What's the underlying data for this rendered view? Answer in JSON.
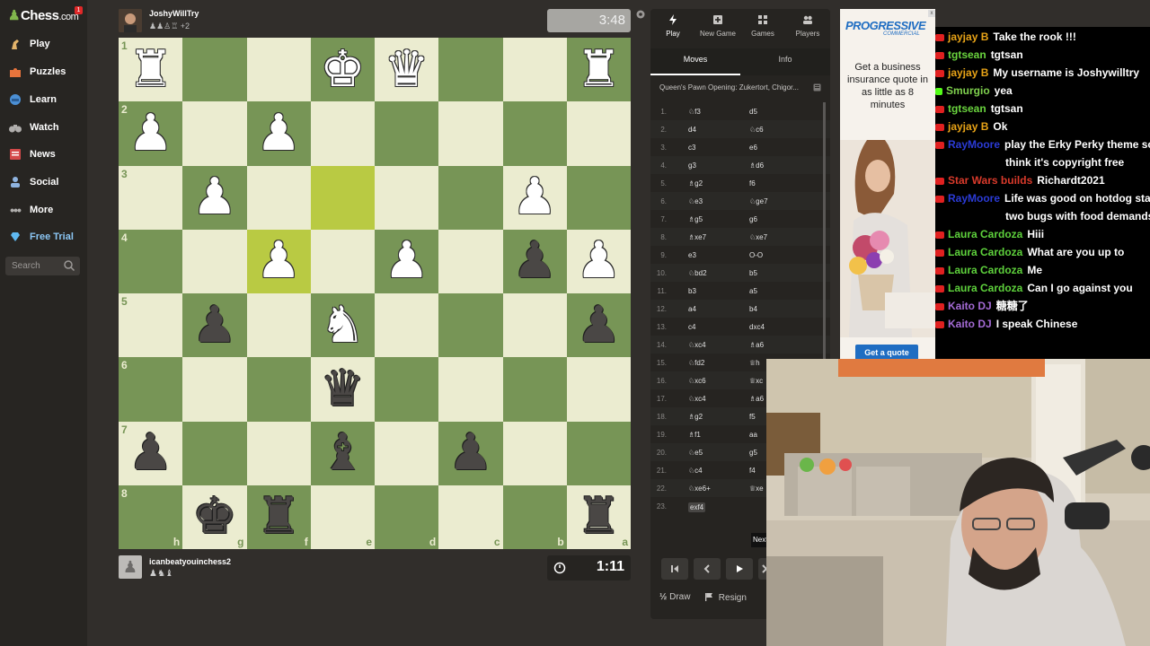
{
  "sidebar": {
    "logo": "Chess",
    "logo_suffix": ".com",
    "logo_badge": "1",
    "items": [
      {
        "label": "Play",
        "icon": "play-hand-icon"
      },
      {
        "label": "Puzzles",
        "icon": "puzzle-icon"
      },
      {
        "label": "Learn",
        "icon": "learn-hat-icon"
      },
      {
        "label": "Watch",
        "icon": "binoculars-icon"
      },
      {
        "label": "News",
        "icon": "news-icon"
      },
      {
        "label": "Social",
        "icon": "social-icon"
      },
      {
        "label": "More",
        "icon": "more-dots-icon"
      },
      {
        "label": "Free Trial",
        "icon": "diamond-icon"
      }
    ],
    "search_placeholder": "Search"
  },
  "top_player": {
    "name": "JoshyWillTry",
    "captured": "♟♟♙♖ +2"
  },
  "top_clock": "3:48",
  "bottom_player": {
    "name": "icanbeatyouinchess2",
    "captured": "♟♞♝"
  },
  "bottom_clock": "1:11",
  "board": {
    "rows": [
      [
        "wR",
        "",
        "",
        "wK",
        "wQ",
        "",
        "",
        "wR"
      ],
      [
        "wP",
        "",
        "wP",
        "",
        "",
        "",
        "",
        ""
      ],
      [
        "",
        "wP",
        "",
        "",
        "",
        "",
        "wP",
        ""
      ],
      [
        "",
        "",
        "wP",
        "",
        "wP",
        "",
        "bP",
        "wP"
      ],
      [
        "",
        "bP",
        "",
        "wN",
        "",
        "",
        "",
        "bP"
      ],
      [
        "",
        "",
        "",
        "bQ",
        "",
        "",
        "",
        ""
      ],
      [
        "bP",
        "",
        "",
        "bB",
        "",
        "bP",
        "",
        ""
      ],
      [
        "",
        "bK",
        "bR",
        "",
        "",
        "",
        "",
        "bR"
      ]
    ],
    "ranks": [
      "1",
      "2",
      "3",
      "4",
      "5",
      "6",
      "7",
      "8"
    ],
    "files": [
      "h",
      "g",
      "f",
      "e",
      "d",
      "c",
      "b",
      "a"
    ],
    "highlight": [
      [
        2,
        3
      ],
      [
        3,
        2
      ]
    ]
  },
  "panel": {
    "tabs": [
      {
        "label": "Play",
        "icon": "lightning-icon"
      },
      {
        "label": "New Game",
        "icon": "plus-square-icon"
      },
      {
        "label": "Games",
        "icon": "games-grid-icon"
      },
      {
        "label": "Players",
        "icon": "players-icon"
      }
    ],
    "subtabs": [
      "Moves",
      "Info"
    ],
    "opening": "Queen's Pawn Opening: Zukertort, Chigor...",
    "moves": [
      {
        "n": "1.",
        "w": "♘f3",
        "b": "d5"
      },
      {
        "n": "2.",
        "w": "d4",
        "b": "♘c6"
      },
      {
        "n": "3.",
        "w": "c3",
        "b": "e6"
      },
      {
        "n": "4.",
        "w": "g3",
        "b": "♗d6"
      },
      {
        "n": "5.",
        "w": "♗g2",
        "b": "f6"
      },
      {
        "n": "6.",
        "w": "♘e3",
        "b": "♘ge7"
      },
      {
        "n": "7.",
        "w": "♗g5",
        "b": "g6"
      },
      {
        "n": "8.",
        "w": "♗xe7",
        "b": "♘xe7"
      },
      {
        "n": "9.",
        "w": "e3",
        "b": "O-O"
      },
      {
        "n": "10.",
        "w": "♘bd2",
        "b": "b5"
      },
      {
        "n": "11.",
        "w": "b3",
        "b": "a5"
      },
      {
        "n": "12.",
        "w": "a4",
        "b": "b4"
      },
      {
        "n": "13.",
        "w": "c4",
        "b": "dxc4"
      },
      {
        "n": "14.",
        "w": "♘xc4",
        "b": "♗a6"
      },
      {
        "n": "15.",
        "w": "♘fd2",
        "b": "♕h"
      },
      {
        "n": "16.",
        "w": "♘xc6",
        "b": "♕xc"
      },
      {
        "n": "17.",
        "w": "♘xc4",
        "b": "♗a6"
      },
      {
        "n": "18.",
        "w": "♗g2",
        "b": "f5"
      },
      {
        "n": "19.",
        "w": "♗f1",
        "b": "aa"
      },
      {
        "n": "20.",
        "w": "♘e5",
        "b": "g5"
      },
      {
        "n": "21.",
        "w": "♘c4",
        "b": "f4"
      },
      {
        "n": "22.",
        "w": "♘xe6+",
        "b": "♕xe"
      },
      {
        "n": "23.",
        "w": "exf4",
        "b": ""
      }
    ],
    "draw_label": "Draw",
    "resign_label": "Resign",
    "draw_icon_text": "½",
    "next_tip": "Next"
  },
  "ad": {
    "brand": "PROGRESSIVE",
    "brand_sub": "COMMERCIAL",
    "copy": "Get a business insurance quote in as little as 8 minutes",
    "cta": "Get a quote",
    "close": "x"
  },
  "chat": [
    {
      "user": "jayjay B",
      "color": "#e8a317",
      "badge": "yt",
      "msg": "Take the rook !!!"
    },
    {
      "user": "tgtsean",
      "color": "#6ad43e",
      "badge": "yt",
      "msg": "tgtsan"
    },
    {
      "user": "jayjay B",
      "color": "#e8a317",
      "badge": "yt",
      "msg": "My username is Joshywilltry"
    },
    {
      "user": "Smurgio",
      "color": "#7fd14e",
      "badge": "kick",
      "msg": "yea"
    },
    {
      "user": "tgtsean",
      "color": "#6ad43e",
      "badge": "yt",
      "msg": "tgtsan"
    },
    {
      "user": "jayjay B",
      "color": "#e8a317",
      "badge": "yt",
      "msg": "Ok"
    },
    {
      "user": "RayMoore",
      "color": "#2b3bd6",
      "badge": "yt",
      "msg": "play the Erky Perky theme so",
      "cont": "think it's copyright free"
    },
    {
      "user": "Star Wars builds",
      "color": "#d93a2b",
      "badge": "yt",
      "msg": "Richardt2021"
    },
    {
      "user": "RayMoore",
      "color": "#2b3bd6",
      "badge": "yt",
      "msg": "Life was good on hotdog sta",
      "cont": "two bugs with food demands"
    },
    {
      "user": "Laura Cardoza",
      "color": "#5ed13c",
      "badge": "yt",
      "msg": "Hiii"
    },
    {
      "user": "Laura Cardoza",
      "color": "#5ed13c",
      "badge": "yt",
      "msg": "What are you up to"
    },
    {
      "user": "Laura Cardoza",
      "color": "#5ed13c",
      "badge": "yt",
      "msg": "Me"
    },
    {
      "user": "Laura Cardoza",
      "color": "#5ed13c",
      "badge": "yt",
      "msg": "Can I go against you"
    },
    {
      "user": "Kaito DJ",
      "color": "#a36ad4",
      "badge": "yt",
      "msg": "糖糖了"
    },
    {
      "user": "Kaito DJ",
      "color": "#a36ad4",
      "badge": "yt",
      "msg": "I speak Chinese"
    }
  ]
}
